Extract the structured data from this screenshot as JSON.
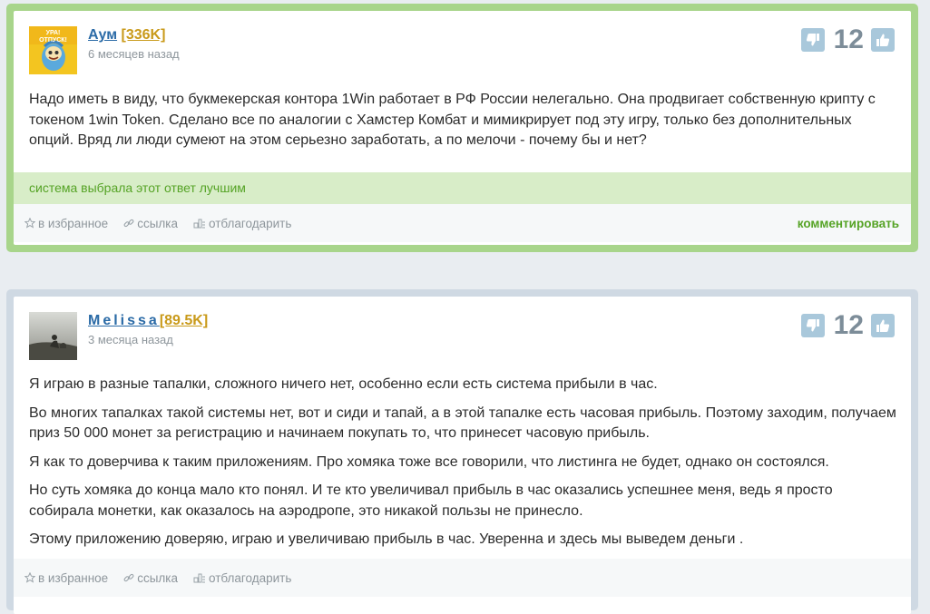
{
  "colors": {
    "best_border": "#a8d58b",
    "normal_border": "#cfd9e3",
    "best_bar_bg": "#d8edc8",
    "accent_green": "#55a325",
    "author_blue": "#2a6aa6",
    "score_gold": "#c99a1a",
    "vote_button": "#a9c8db"
  },
  "answers": [
    {
      "author": {
        "name": "Аум",
        "score": "[336K]"
      },
      "time": "6 месяцев назад",
      "rating": "12",
      "avatar_text": {
        "line1": "УРА!",
        "line2": "ОТПУСК!"
      },
      "paragraphs": [
        "Надо иметь в виду, что букмекерская контора 1Win работает в РФ России нелегально. Она продвигает собственную крипту с токеном 1win Token. Сделано все по аналогии с Хамстер Комбат и мимикрирует под эту игру, только без дополнительных опций. Вряд ли люди сумеют на этом серьезно заработать, а по мелочи - почему бы и нет?"
      ],
      "best_label": "система выбрала этот ответ лучшим",
      "footer": {
        "favorite": "в избранное",
        "link": "ссылка",
        "thank": "отблагодарить",
        "comment": "комментировать"
      }
    },
    {
      "author": {
        "name": "Melissa",
        "score": "[89.5K]"
      },
      "time": "3 месяца назад",
      "rating": "12",
      "paragraphs": [
        "Я играю в разные тапалки, сложного ничего нет, особенно если есть система прибыли в час.",
        "Во многих тапалках такой системы нет, вот и сиди и тапай, а в этой тапалке есть часовая прибыль. Поэтому заходим, получаем приз 50 000 монет за регистрацию и начинаем покупать то, что принесет часовую прибыль.",
        "Я как то доверчива к таким приложениям. Про хомяка тоже все говорили, что листинга не будет, однако он состоялся.",
        "Но суть хомяка до конца мало кто понял. И те кто увеличивал прибыль в час оказались успешнее меня, ведь я просто собирала монетки, как оказалось на аэродропе, это никакой пользы не принесло.",
        "Этому приложению доверяю, играю и увеличиваю прибыль в час. Уверенна и здесь мы выведем деньги ."
      ],
      "footer": {
        "favorite": "в избранное",
        "link": "ссылка",
        "thank": "отблагодарить"
      }
    }
  ]
}
